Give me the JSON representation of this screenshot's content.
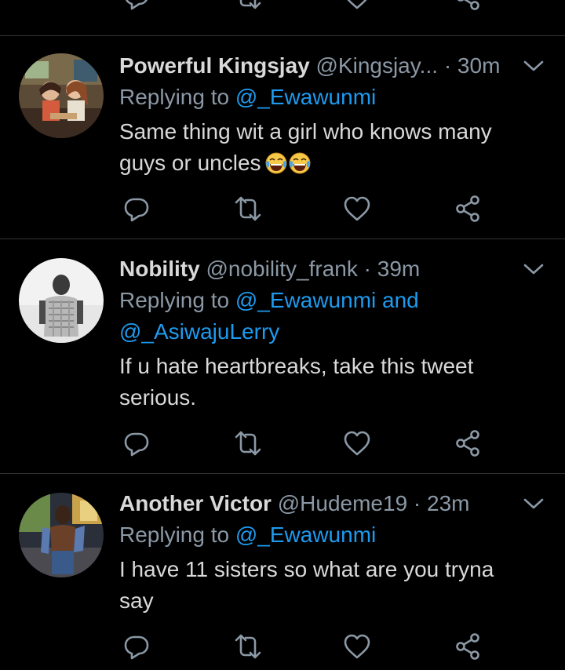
{
  "colors": {
    "background": "#000000",
    "text": "#d9d9d9",
    "muted": "#8b98a5",
    "accent": "#1d9bf0",
    "divider": "#2f3336"
  },
  "icons": {
    "reply": "comment-icon",
    "retweet": "retweet-icon",
    "like": "heart-icon",
    "share": "share-icon",
    "menu": "chevron-down-icon"
  },
  "tweets": [
    {
      "name": "Powerful Kingsjay",
      "handle": "@Kingsjay...",
      "separator": "·",
      "time": "30m",
      "reply_prefix": "Replying to",
      "reply_to": "@_Ewawunmi",
      "reply_and": "",
      "reply_to_2": "",
      "body": [
        "Same thing wit a girl who knows many",
        "guys or uncles"
      ],
      "emoji": [
        "face-with-tears-of-joy",
        "face-with-tears-of-joy"
      ]
    },
    {
      "name": "Nobility",
      "handle": "@nobility_frank",
      "separator": "·",
      "time": "39m",
      "reply_prefix": "Replying to",
      "reply_to": "@_Ewawunmi",
      "reply_and": "and",
      "reply_to_2": "@_AsiwajuLerry",
      "body": [
        "If u hate heartbreaks, take this tweet",
        "serious."
      ]
    },
    {
      "name": "Another Victor",
      "handle": "@Hudeme19",
      "separator": "·",
      "time": "23m",
      "reply_prefix": "Replying to",
      "reply_to": "@_Ewawunmi",
      "reply_and": "",
      "reply_to_2": "",
      "body": [
        "I have 11 sisters so what are you tryna",
        "say"
      ]
    }
  ]
}
